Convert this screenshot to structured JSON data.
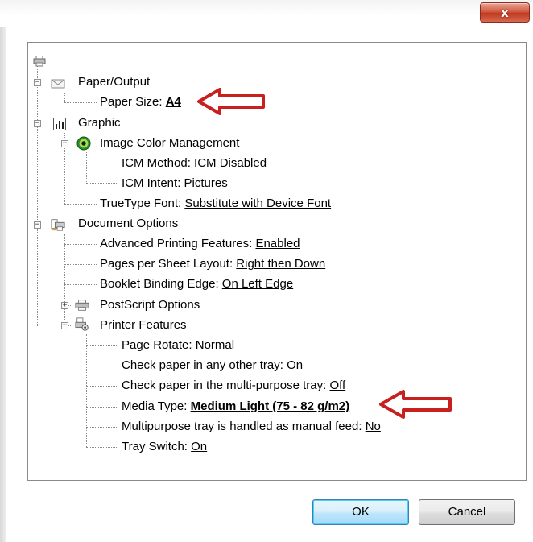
{
  "window": {
    "close_glyph": "x",
    "colors": {
      "close": "#c0391f",
      "arrow": "#c8201f"
    }
  },
  "tree": {
    "root_icon": "printer-icon",
    "paper_output": {
      "label": "Paper/Output",
      "icon": "paper-output-icon"
    },
    "paper_size": {
      "label": "Paper Size: ",
      "value": "A4"
    },
    "graphic": {
      "label": "Graphic",
      "icon": "graphic-icon"
    },
    "icm": {
      "label": "Image Color Management",
      "icon": "color-management-icon"
    },
    "icm_method": {
      "label": "ICM Method: ",
      "value": "ICM Disabled"
    },
    "icm_intent": {
      "label": "ICM Intent: ",
      "value": "Pictures"
    },
    "truetype": {
      "label": "TrueType Font: ",
      "value": "Substitute with Device Font"
    },
    "document_options": {
      "label": "Document Options",
      "icon": "document-options-icon"
    },
    "advanced": {
      "label": "Advanced Printing Features: ",
      "value": "Enabled"
    },
    "pages_per_sheet": {
      "label": "Pages per Sheet Layout: ",
      "value": "Right then Down"
    },
    "booklet": {
      "label": "Booklet Binding Edge: ",
      "value": "On Left Edge"
    },
    "postscript": {
      "label": "PostScript Options",
      "icon": "postscript-icon"
    },
    "printer_features": {
      "label": "Printer Features",
      "icon": "printer-features-icon"
    },
    "page_rotate": {
      "label": "Page Rotate: ",
      "value": "Normal"
    },
    "check_other": {
      "label": "Check paper in any other tray: ",
      "value": "On"
    },
    "check_mp": {
      "label": "Check paper in the multi-purpose tray: ",
      "value": "Off"
    },
    "media_type": {
      "label": "Media Type: ",
      "value": "Medium Light (75 - 82 g/m2)"
    },
    "mp_manual": {
      "label": "Multipurpose tray is handled as manual feed: ",
      "value": "No"
    },
    "tray_switch": {
      "label": "Tray Switch: ",
      "value": "On"
    }
  },
  "buttons": {
    "ok": "OK",
    "cancel": "Cancel"
  }
}
